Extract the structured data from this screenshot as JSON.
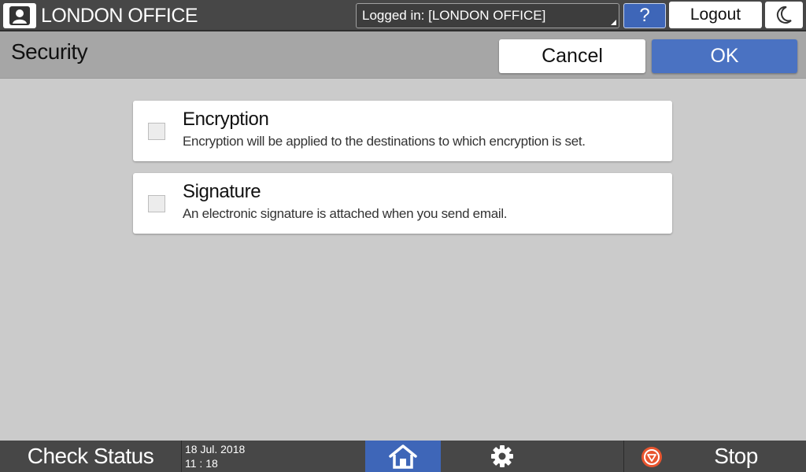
{
  "header": {
    "user_name": "LONDON OFFICE",
    "login_status": "Logged in: [LONDON OFFICE]",
    "help_label": "?",
    "logout_label": "Logout"
  },
  "titlebar": {
    "title": "Security",
    "cancel_label": "Cancel",
    "ok_label": "OK"
  },
  "options": [
    {
      "title": "Encryption",
      "description": "Encryption will be applied to the destinations to which encryption is set.",
      "checked": false
    },
    {
      "title": "Signature",
      "description": "An electronic signature is attached when you send email.",
      "checked": false
    }
  ],
  "footer": {
    "check_status_label": "Check Status",
    "date": "18 Jul. 2018",
    "time": "11 : 18",
    "stop_label": "Stop"
  },
  "icons": {
    "user": "user-icon",
    "energy": "moon-icon",
    "home": "home-icon",
    "settings": "gear-icon",
    "stop": "stop-icon"
  },
  "colors": {
    "accent": "#4a72c2",
    "topbar": "#474747",
    "stop": "#e8552f"
  }
}
